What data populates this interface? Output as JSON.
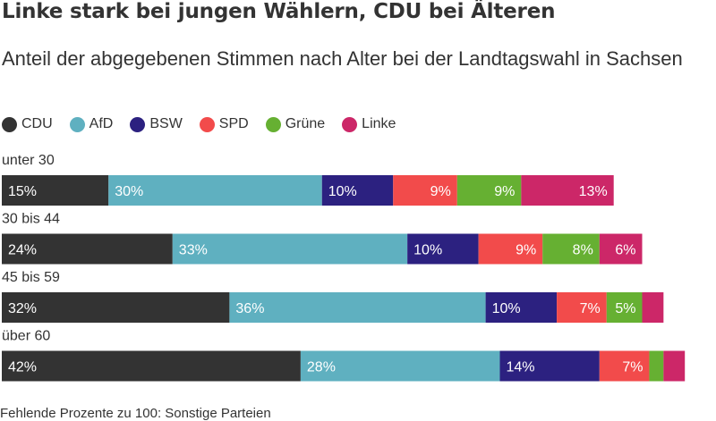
{
  "chart_data": {
    "type": "bar",
    "orientation": "horizontal",
    "stacked": true,
    "title": "Linke stark bei jungen Wählern, CDU bei Älteren",
    "subtitle": "Anteil der abgegebenen Stimmen nach Alter bei der Landtagswahl in Sachsen",
    "footnote": "Fehlende Prozente zu 100: Sonstige Parteien",
    "xlim": [
      0,
      100
    ],
    "value_suffix": "%",
    "legend_position": "top-left",
    "grid": false,
    "categories": [
      "unter 30",
      "30 bis 44",
      "45 bis 59",
      "über 60"
    ],
    "series": [
      {
        "name": "CDU",
        "color": "#333333",
        "values": [
          15,
          24,
          32,
          42
        ]
      },
      {
        "name": "AfD",
        "color": "#5fb0c0",
        "values": [
          30,
          33,
          36,
          28
        ]
      },
      {
        "name": "BSW",
        "color": "#2c2180",
        "values": [
          10,
          10,
          10,
          14
        ]
      },
      {
        "name": "SPD",
        "color": "#f24b4b",
        "values": [
          9,
          9,
          7,
          7
        ]
      },
      {
        "name": "Grüne",
        "color": "#66b032",
        "values": [
          9,
          8,
          5,
          2
        ]
      },
      {
        "name": "Linke",
        "color": "#cc2768",
        "values": [
          13,
          6,
          3,
          3
        ]
      }
    ],
    "label_min_value": 5
  }
}
